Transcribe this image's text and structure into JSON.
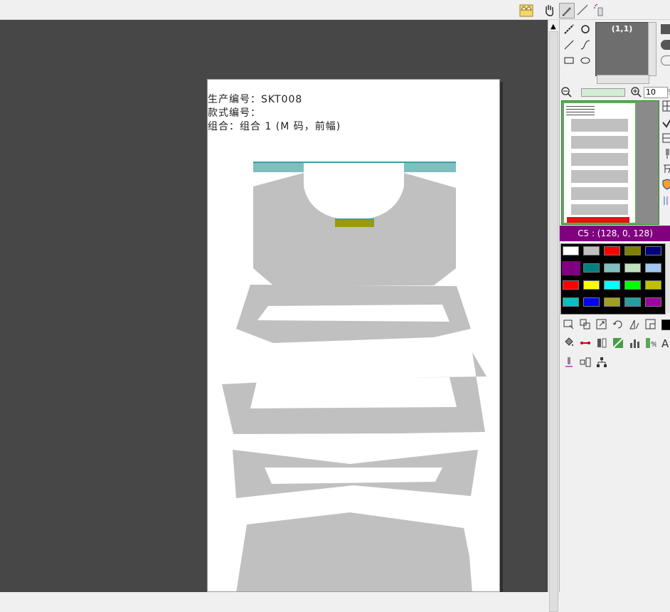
{
  "toolbar": {
    "icons": [
      "crown-icon",
      "hand-icon",
      "pen-nib-icon",
      "line-pen-icon",
      "spray-icon"
    ]
  },
  "document": {
    "production_no": "生产编号：SKT008",
    "style_no": "款式编号：",
    "combination": "组合：组合 1 (M 码，前幅)"
  },
  "navigator": {
    "coord": "(1,1)",
    "zoom_value": "10",
    "zoom_suffix": "%"
  },
  "color": {
    "current_label": "C5 : (128, 0, 128)",
    "current_hex": "#800080"
  },
  "palette": [
    [
      "#ffffff",
      "#c0c0c0",
      "#ff0000",
      "#808000",
      "#000080"
    ],
    [
      "#800080",
      "#008080",
      "#80c0c0",
      "#c0e0c0",
      "#a0c8f0"
    ],
    [
      "#ff0000",
      "#ffff00",
      "#00ffff",
      "#00ff00",
      "#c0c000"
    ],
    [
      "#00c0c0",
      "#0000ff",
      "#a0a020",
      "#20a0a0",
      "#a000a0"
    ]
  ],
  "knit_colors": {
    "body": "#c0c0c0",
    "rib": "#7fbfbf",
    "label": "#9a9a10",
    "marker": "#e81010"
  }
}
